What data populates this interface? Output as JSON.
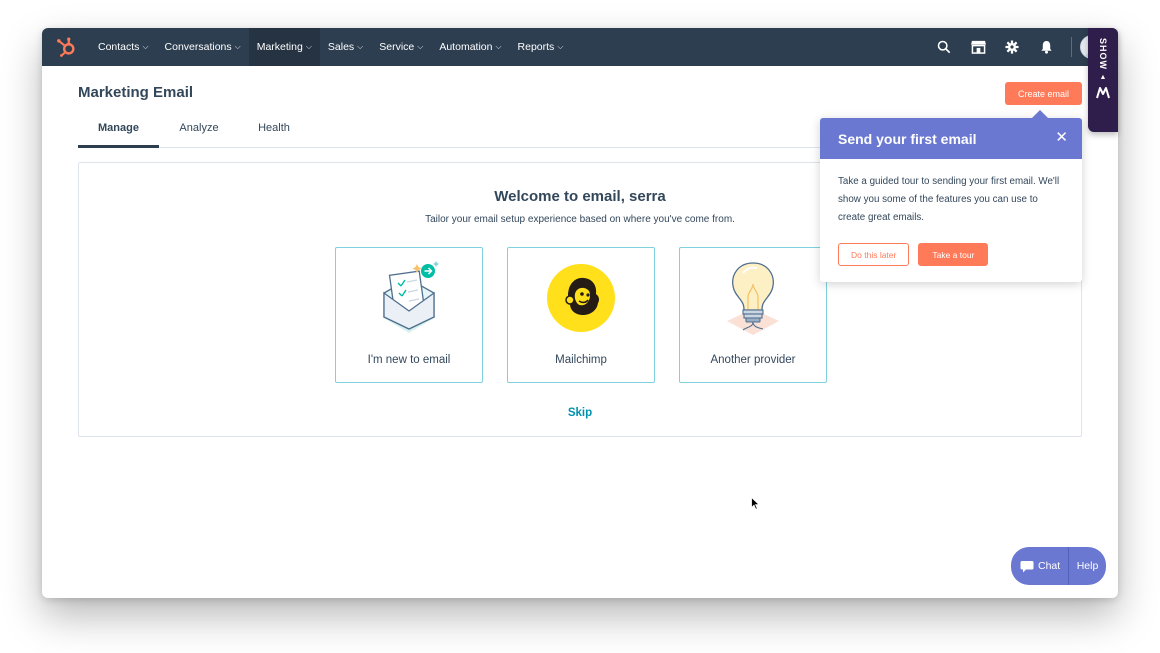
{
  "nav": {
    "items": [
      {
        "label": "Contacts",
        "active": false
      },
      {
        "label": "Conversations",
        "active": false
      },
      {
        "label": "Marketing",
        "active": true
      },
      {
        "label": "Sales",
        "active": false
      },
      {
        "label": "Service",
        "active": false
      },
      {
        "label": "Automation",
        "active": false
      },
      {
        "label": "Reports",
        "active": false
      }
    ],
    "icons": [
      "search-icon",
      "marketplace-icon",
      "gear-icon",
      "bell-icon"
    ]
  },
  "extension": {
    "label": "SHOW"
  },
  "page": {
    "title": "Marketing Email",
    "create_button": "Create email",
    "tabs": [
      {
        "label": "Manage",
        "active": true
      },
      {
        "label": "Analyze",
        "active": false
      },
      {
        "label": "Health",
        "active": false
      }
    ]
  },
  "welcome": {
    "title": "Welcome to email, serra",
    "subtitle": "Tailor your email setup experience based on where you've come from.",
    "options": [
      {
        "label": "I'm new to email",
        "icon": "envelope-illustration"
      },
      {
        "label": "Mailchimp",
        "icon": "mailchimp-logo"
      },
      {
        "label": "Another provider",
        "icon": "lightbulb-illustration"
      }
    ],
    "skip": "Skip"
  },
  "tour": {
    "title": "Send your first email",
    "body": "Take a guided tour to sending your first email. We'll show you some of the features you can use to create great emails.",
    "later_button": "Do this later",
    "tour_button": "Take a tour"
  },
  "chat": {
    "chat_label": "Chat",
    "help_label": "Help"
  },
  "colors": {
    "nav_bg": "#2d3e50",
    "accent_orange": "#ff7a59",
    "popover_purple": "#6a78d1",
    "link_teal": "#0091ae",
    "logo_orange": "#ff7a59"
  }
}
